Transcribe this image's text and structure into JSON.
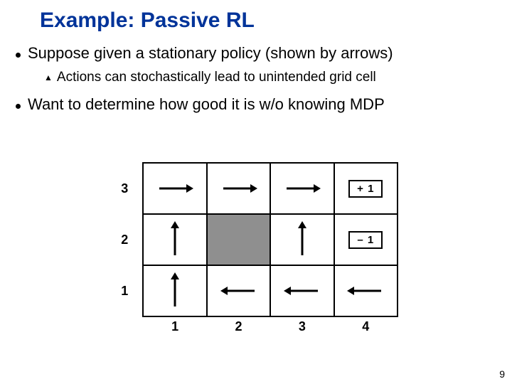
{
  "title": "Example: Passive RL",
  "bullets": {
    "b1": "Suppose given a stationary policy (shown by arrows)",
    "b1_sub": "Actions can stochastically lead to unintended grid cell",
    "b2": "Want to determine how good it is w/o knowing MDP"
  },
  "grid": {
    "row_labels": [
      "3",
      "2",
      "1"
    ],
    "col_labels": [
      "1",
      "2",
      "3",
      "4"
    ],
    "rewards": {
      "r3c4": "+ 1",
      "r2c4": "– 1"
    }
  },
  "page_number": "9"
}
